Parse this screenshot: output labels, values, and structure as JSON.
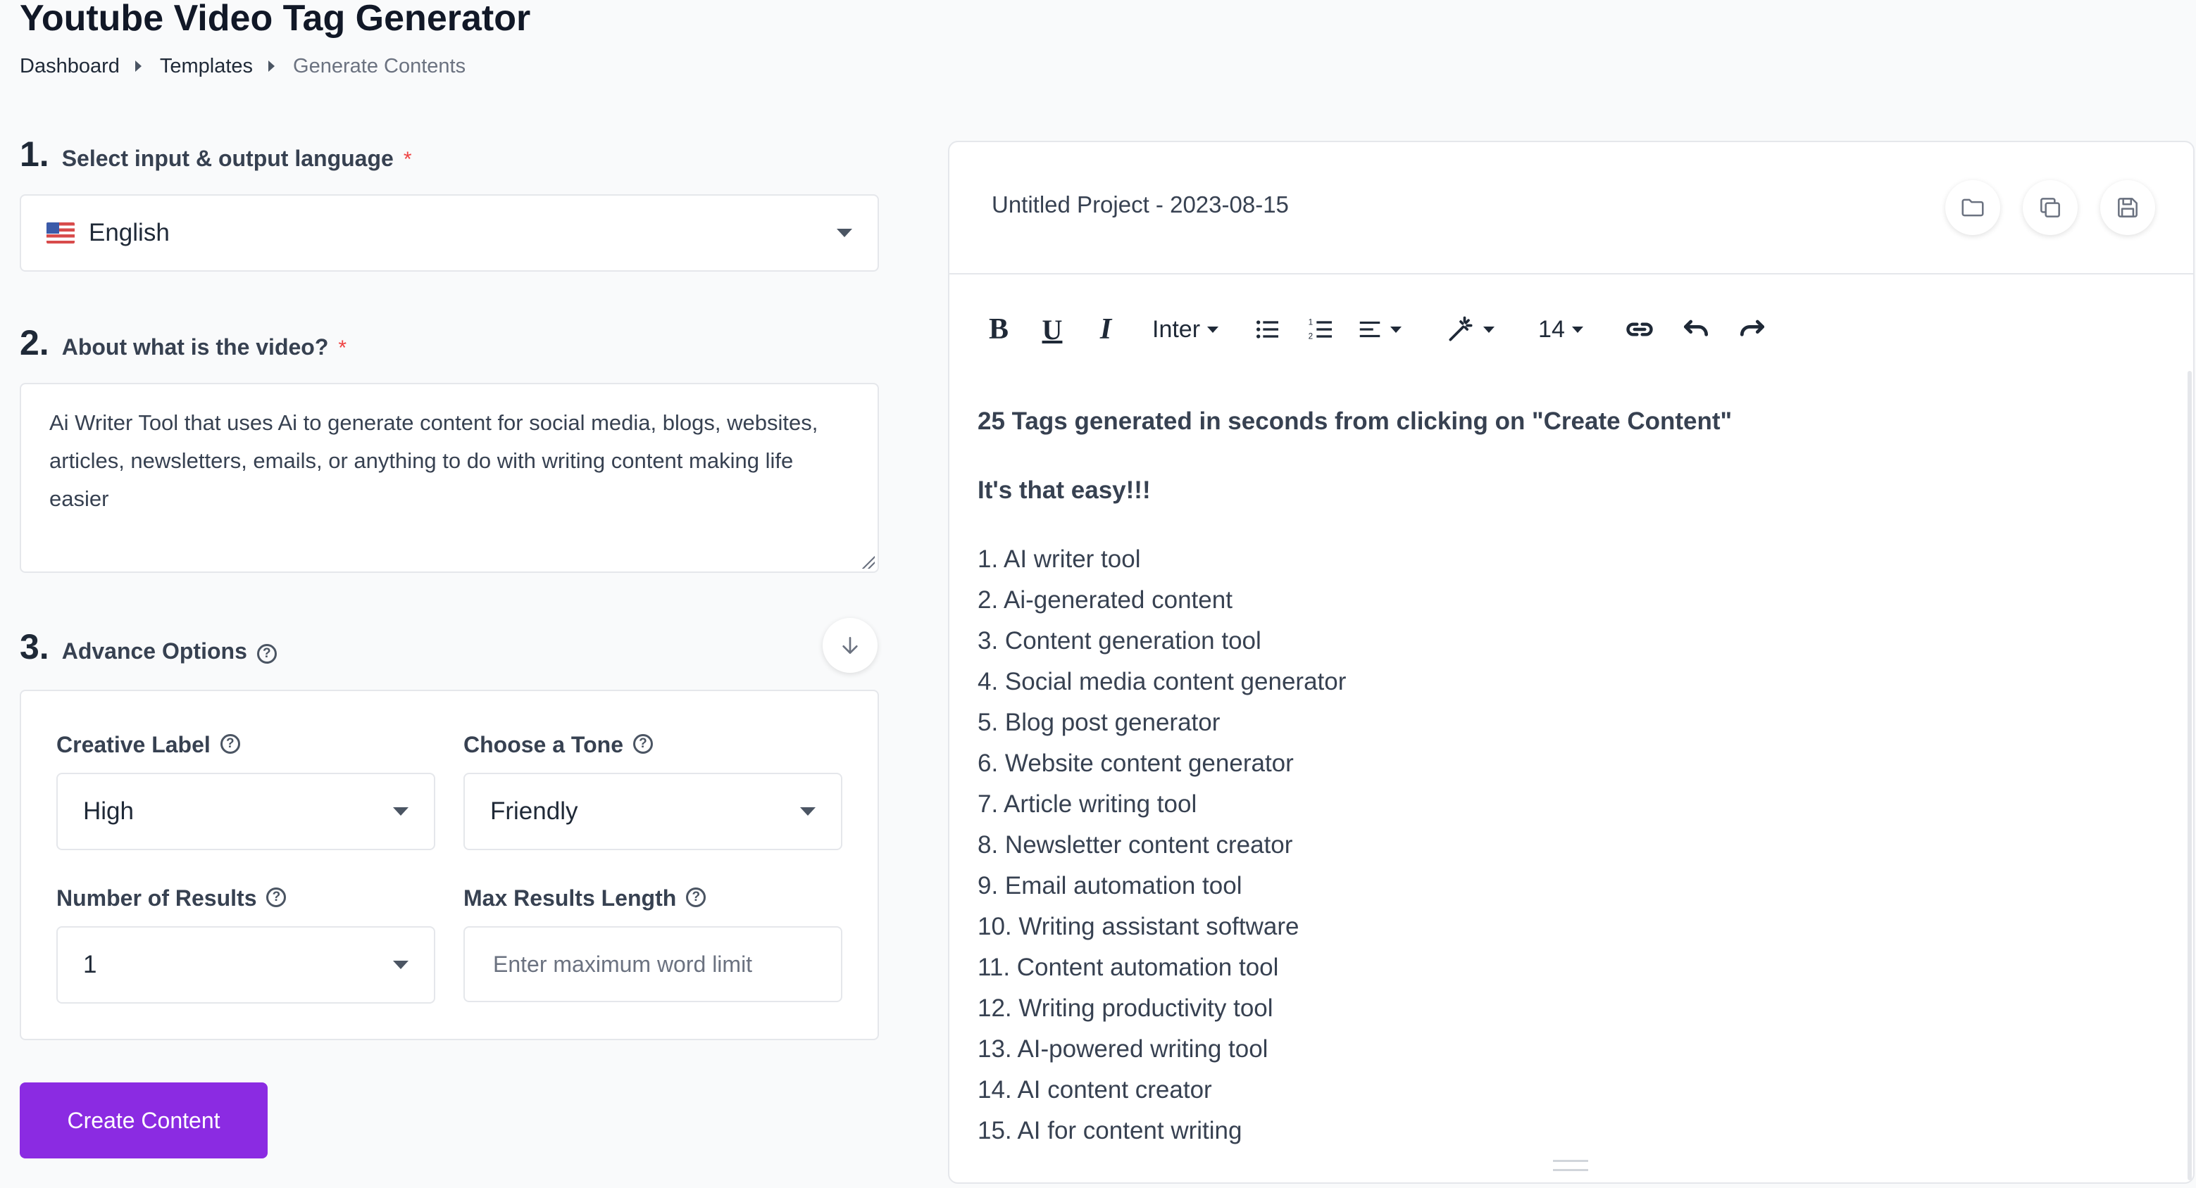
{
  "page": {
    "title": "Youtube Video Tag Generator",
    "breadcrumb": [
      "Dashboard",
      "Templates",
      "Generate Contents"
    ]
  },
  "step1": {
    "number": "1.",
    "label": "Select input & output language",
    "required": "*",
    "language": "English"
  },
  "step2": {
    "number": "2.",
    "label": "About what is the video?",
    "required": "*",
    "value": "Ai Writer Tool that uses Ai to generate content for social media, blogs, websites, articles, newsletters, emails, or anything to do with writing content making life easier"
  },
  "step3": {
    "number": "3.",
    "label": "Advance Options",
    "creative_label": {
      "label": "Creative Label",
      "value": "High"
    },
    "tone": {
      "label": "Choose a Tone",
      "value": "Friendly"
    },
    "num_results": {
      "label": "Number of Results",
      "value": "1"
    },
    "max_length": {
      "label": "Max Results Length",
      "placeholder": "Enter maximum word limit"
    }
  },
  "create_button": "Create Content",
  "editor": {
    "project_title": "Untitled Project - 2023-08-15",
    "toolbar": {
      "font": "Inter",
      "size": "14",
      "icons": [
        "bold-icon",
        "underline-icon",
        "italic-icon",
        "font-select",
        "bullet-list-icon",
        "numbered-list-icon",
        "align-icon",
        "magic-wand-icon",
        "font-size-select",
        "link-icon",
        "undo-icon",
        "redo-icon"
      ]
    },
    "heading": "25 Tags generated in seconds from clicking on \"Create Content\"",
    "subheading": "It's that easy!!!",
    "tags": [
      "1. AI writer tool",
      "2. Ai-generated content",
      "3. Content generation tool",
      "4. Social media content generator",
      "5. Blog post generator",
      "6. Website content generator",
      "7. Article writing tool",
      "8. Newsletter content creator",
      "9. Email automation tool",
      "10. Writing assistant software",
      "11. Content automation tool",
      "12. Writing productivity tool",
      "13. AI-powered writing tool",
      "14. AI content creator",
      "15. AI for content writing"
    ]
  },
  "colors": {
    "accent": "#8b2be2",
    "required": "#ef4444",
    "background": "#f9fafb"
  }
}
